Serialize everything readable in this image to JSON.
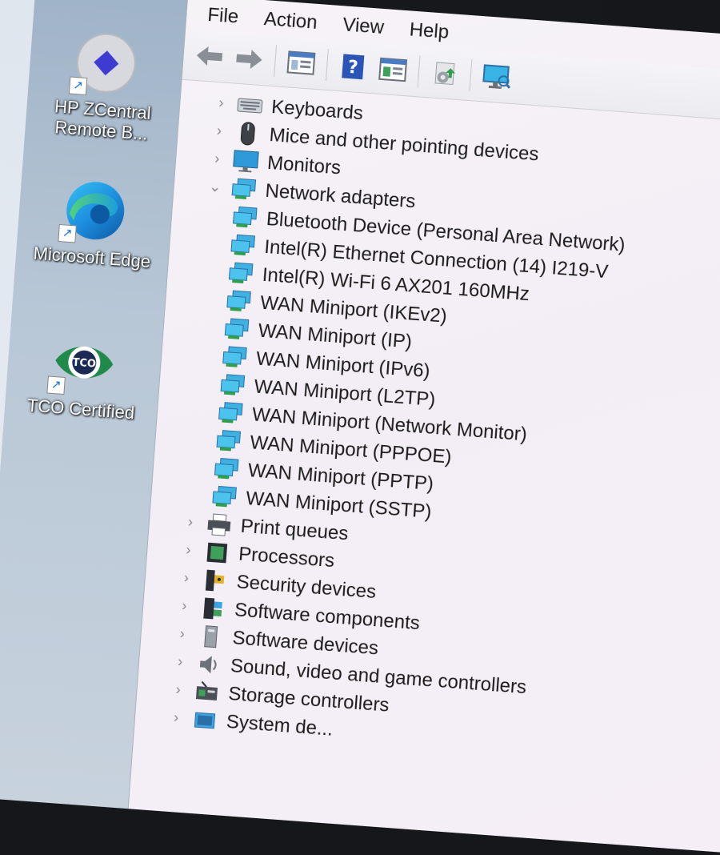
{
  "desktop": {
    "icons": [
      {
        "label": "HP ZCentral Remote B...",
        "icon": "hp-zcentral-icon"
      },
      {
        "label": "Microsoft Edge",
        "icon": "edge-icon"
      },
      {
        "label": "TCO Certified",
        "icon": "tco-certified-icon"
      }
    ]
  },
  "menubar": {
    "file": "File",
    "action": "Action",
    "view": "View",
    "help": "Help"
  },
  "toolbar": {
    "icons": [
      "back-arrow-icon",
      "forward-arrow-icon",
      "show-hide-tree-icon",
      "help-icon",
      "properties-icon",
      "update-driver-icon",
      "scan-hardware-icon"
    ]
  },
  "tree": {
    "categories_before": [
      {
        "label": "Keyboards",
        "icon": "keyboard-icon",
        "expanded": false
      },
      {
        "label": "Mice and other pointing devices",
        "icon": "mouse-icon",
        "expanded": false
      },
      {
        "label": "Monitors",
        "icon": "monitor-icon",
        "expanded": false
      }
    ],
    "network": {
      "label": "Network adapters",
      "expanded": true,
      "children": [
        "Bluetooth Device (Personal Area Network)",
        "Intel(R) Ethernet Connection (14) I219-V",
        "Intel(R) Wi-Fi 6 AX201 160MHz",
        "WAN Miniport (IKEv2)",
        "WAN Miniport (IP)",
        "WAN Miniport (IPv6)",
        "WAN Miniport (L2TP)",
        "WAN Miniport (Network Monitor)",
        "WAN Miniport (PPPOE)",
        "WAN Miniport (PPTP)",
        "WAN Miniport (SSTP)"
      ]
    },
    "categories_after": [
      {
        "label": "Print queues",
        "icon": "printer-icon"
      },
      {
        "label": "Processors",
        "icon": "processor-icon"
      },
      {
        "label": "Security devices",
        "icon": "security-device-icon"
      },
      {
        "label": "Software components",
        "icon": "software-component-icon"
      },
      {
        "label": "Software devices",
        "icon": "software-device-icon"
      },
      {
        "label": "Sound, video and game controllers",
        "icon": "speaker-icon"
      },
      {
        "label": "Storage controllers",
        "icon": "storage-controller-icon"
      },
      {
        "label": "System de...",
        "icon": "system-device-icon"
      }
    ]
  }
}
